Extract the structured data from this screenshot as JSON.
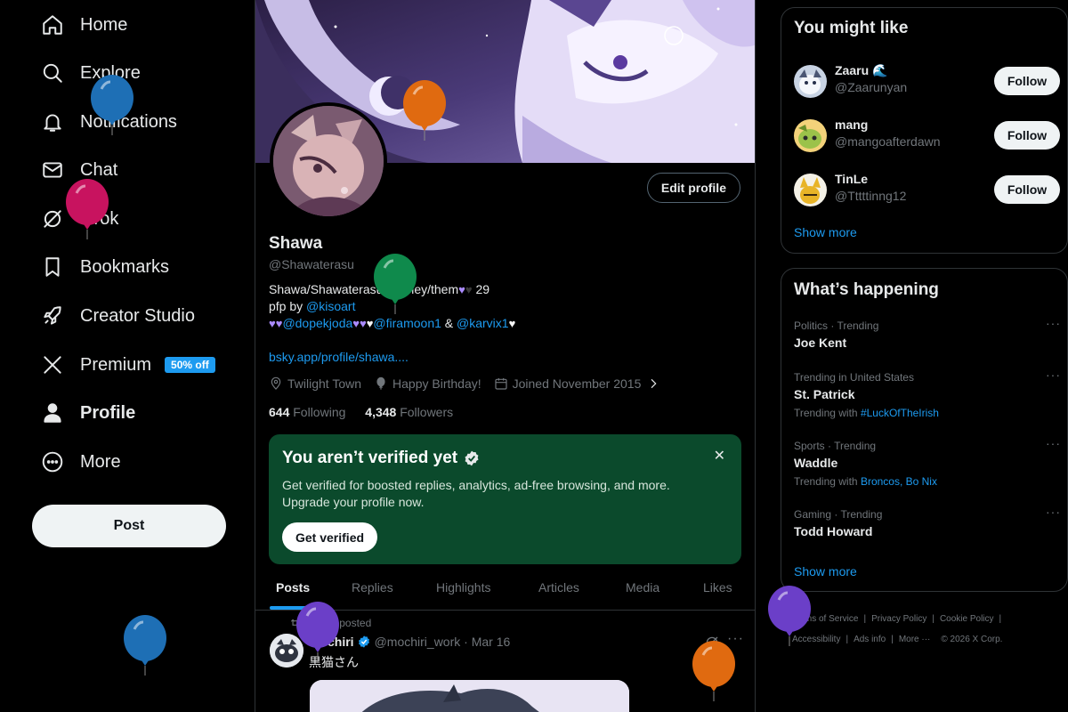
{
  "nav": {
    "items": [
      {
        "label": "Home",
        "icon": "home-icon"
      },
      {
        "label": "Explore",
        "icon": "search-icon"
      },
      {
        "label": "Notifications",
        "icon": "bell-icon"
      },
      {
        "label": "Chat",
        "icon": "mail-icon"
      },
      {
        "label": "Grok",
        "icon": "grok-icon"
      },
      {
        "label": "Bookmarks",
        "icon": "bookmark-icon"
      },
      {
        "label": "Creator Studio",
        "icon": "rocket-icon"
      },
      {
        "label": "Premium",
        "icon": "x-logo-icon",
        "badge": "50% off"
      },
      {
        "label": "Profile",
        "icon": "person-icon",
        "active": true
      },
      {
        "label": "More",
        "icon": "more-circle-icon"
      }
    ],
    "post_label": "Post"
  },
  "profile": {
    "edit_label": "Edit profile",
    "name": "Shawa",
    "handle": "@Shawaterasu",
    "bio": {
      "line1_prefix": "Shawa/Shawaterasu ",
      "line1_pronouns": "they/them",
      "line1_age": "29",
      "line2_prefix": "pfp by ",
      "line2_link": "@kisoart",
      "line3_link1": "@dopekjoda",
      "line3_link2": "@firamoon1",
      "line3_amp": " & ",
      "line3_link3": "@karvix1"
    },
    "website": "bsky.app/profile/shawa....",
    "location": "Twilight Town",
    "birthday": "Happy Birthday!",
    "joined": "Joined November 2015",
    "following_count": "644",
    "following_label": "Following",
    "followers_count": "4,348",
    "followers_label": "Followers"
  },
  "verify_card": {
    "title": "You aren’t verified yet",
    "body": "Get verified for boosted replies, analytics, ad-free browsing, and more. Upgrade your profile now.",
    "button": "Get verified",
    "close": "✕",
    "bg_color": "#0b4a2c"
  },
  "tabs": [
    "Posts",
    "Replies",
    "Highlights",
    "Articles",
    "Media",
    "Likes"
  ],
  "tweet": {
    "repost_label": "You reposted",
    "author": "mochiri",
    "handle_date": "@mochiri_work · Mar 16",
    "text": "黒猫さん"
  },
  "you_might_like": {
    "title": "You might like",
    "users": [
      {
        "name": "Zaaru 🌊",
        "handle": "@Zaarunyan",
        "follow": "Follow"
      },
      {
        "name": "mang",
        "handle": "@mangoafterdawn",
        "follow": "Follow"
      },
      {
        "name": "TinLe",
        "handle": "@Tttttinng12",
        "follow": "Follow"
      }
    ],
    "show_more": "Show more"
  },
  "whats_happening": {
    "title": "What’s happening",
    "trends": [
      {
        "category": "Politics · Trending",
        "title": "Joe Kent",
        "with_label": "",
        "with_links": ""
      },
      {
        "category": "Trending in United States",
        "title": "St. Patrick",
        "with_label": "Trending with",
        "with_links": "#LuckOfTheIrish"
      },
      {
        "category": "Sports · Trending",
        "title": "Waddle",
        "with_label": "Trending with",
        "with_links": "Broncos, Bo Nix"
      },
      {
        "category": "Gaming · Trending",
        "title": "Todd Howard",
        "with_label": "",
        "with_links": ""
      }
    ],
    "show_more": "Show more"
  },
  "footer": {
    "links": [
      "Terms of Service",
      "Privacy Policy",
      "Cookie Policy",
      "Accessibility",
      "Ads info",
      "More ···",
      "© 2026 X Corp."
    ]
  },
  "colors": {
    "accent": "#1d9bf0",
    "background": "#000000",
    "text_primary": "#e7e9ea",
    "text_secondary": "#71767b"
  },
  "balloons": [
    {
      "color": "#1e6fb5"
    },
    {
      "color": "#c8135f"
    },
    {
      "color": "#e06a10"
    },
    {
      "color": "#0f8a4c"
    },
    {
      "color": "#1e6fb5"
    },
    {
      "color": "#6b3fc8"
    },
    {
      "color": "#e06a10"
    },
    {
      "color": "#6b3fc8"
    }
  ]
}
